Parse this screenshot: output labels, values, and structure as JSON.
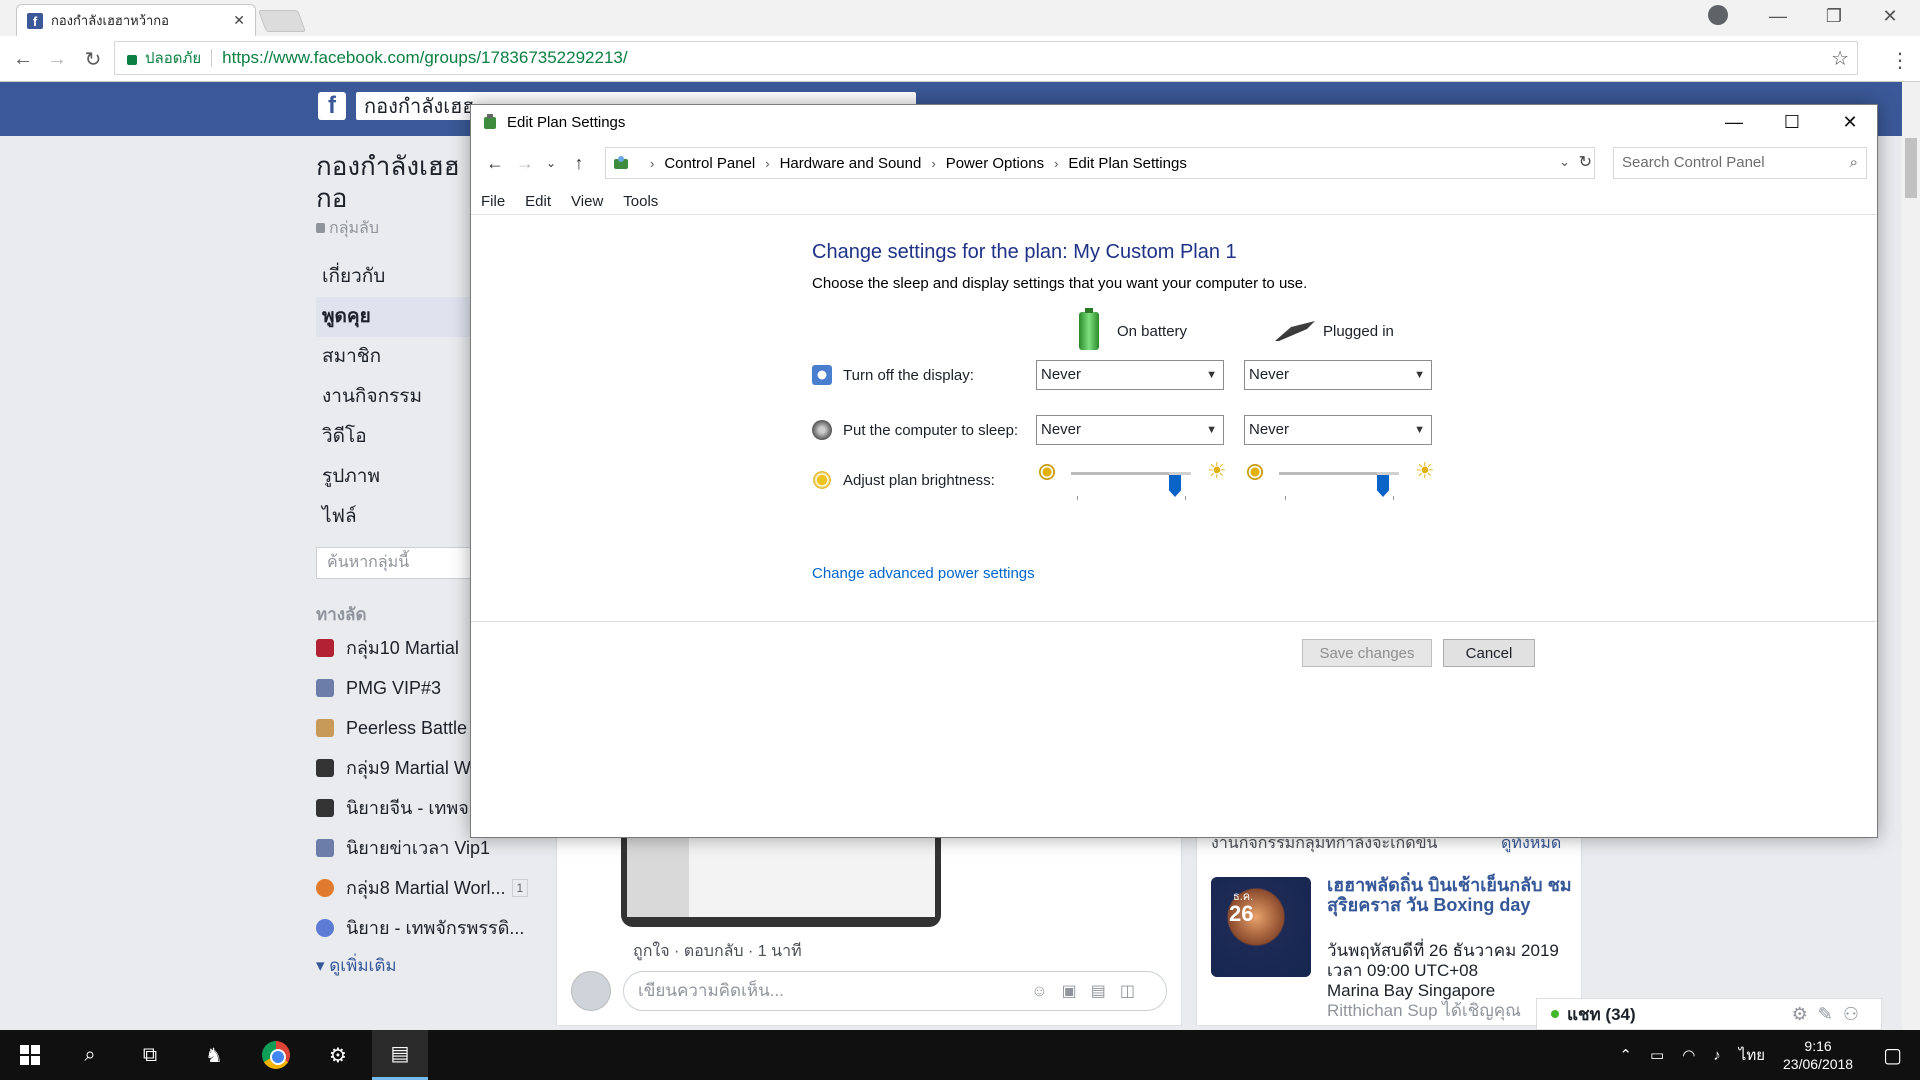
{
  "browser": {
    "tab_title": "กองกำลังเฮฮาหว้ากอ",
    "security_label": "ปลอดภัย",
    "url": "https://www.facebook.com/groups/178367352292213/"
  },
  "facebook": {
    "search_value": "กองกำลังเฮฮ",
    "group_name_line1": "กองกำลังเฮฮ",
    "group_name_line2": "กอ",
    "privacy": "กลุ่มลับ",
    "nav": [
      "เกี่ยวกับ",
      "พูดคุย",
      "สมาชิก",
      "งานกิจกรรม",
      "วิดีโอ",
      "รูปภาพ",
      "ไฟล์"
    ],
    "group_search_placeholder": "ค้นหากลุ่มนี้",
    "shortcuts_title": "ทางลัด",
    "shortcuts": [
      {
        "label": "กลุ่ม10 Martial",
        "color": "#b22234"
      },
      {
        "label": "PMG VIP#3",
        "color": "#6b7da8"
      },
      {
        "label": "Peerless Battle",
        "color": "#c79a5a"
      },
      {
        "label": "กลุ่ม9 Martial W",
        "color": "#333333"
      },
      {
        "label": "นิยายจีน - เทพจ",
        "color": "#333333"
      },
      {
        "label": "นิยายข่าเวลา Vip1",
        "color": "#6b7da8"
      },
      {
        "label": "กลุ่ม8 Martial Worl...",
        "color": "#e07a2e",
        "badge": "1"
      },
      {
        "label": "นิยาย - เทพจักรพรรดิ...",
        "color": "#5b7bd5"
      }
    ],
    "see_more": "ดูเพิ่มเติม",
    "post_actions": "ถูกใจ · ตอบกลับ · 1 นาที",
    "comment_placeholder": "เขียนความคิดเห็น...",
    "events_header": "งานกิจกรรมกลุ่มที่กำลังจะเกิดขึ้น",
    "events_see_all": "ดูทั้งหมด",
    "event": {
      "thumb_month": "ธ.ค.",
      "thumb_day": "26",
      "title": "เฮฮาพลัดถิ่น บินเช้าเย็นกลับ ชมสุริยคราส วัน Boxing day",
      "date": "วันพฤหัสบดีที่ 26 ธันวาคม 2019 เวลา 09:00 UTC+08",
      "place": "Marina Bay Singapore",
      "invited": "Ritthichan Sup ได้เชิญคุณ"
    },
    "chat_label": "แชท (34)"
  },
  "dialog": {
    "title": "Edit Plan Settings",
    "breadcrumbs": [
      "Control Panel",
      "Hardware and Sound",
      "Power Options",
      "Edit Plan Settings"
    ],
    "search_placeholder": "Search Control Panel",
    "menu": [
      "File",
      "Edit",
      "View",
      "Tools"
    ],
    "heading": "Change settings for the plan: My Custom Plan 1",
    "subheading": "Choose the sleep and display settings that you want your computer to use.",
    "col_battery": "On battery",
    "col_plugged": "Plugged in",
    "display_label": "Turn off the display:",
    "display_battery": "Never",
    "display_plugged": "Never",
    "sleep_label": "Put the computer to sleep:",
    "sleep_battery": "Never",
    "sleep_plugged": "Never",
    "brightness_label": "Adjust plan brightness:",
    "brightness_battery_pct": 100,
    "brightness_plugged_pct": 100,
    "advanced_link": "Change advanced power settings",
    "save_label": "Save changes",
    "cancel_label": "Cancel"
  },
  "taskbar": {
    "language": "ไทย",
    "time": "9:16",
    "date": "23/06/2018"
  }
}
